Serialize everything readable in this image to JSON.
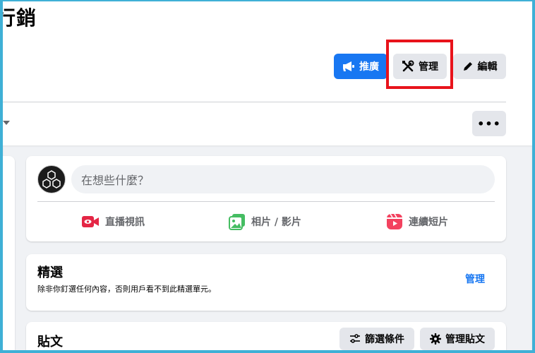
{
  "header": {
    "title": "行銷"
  },
  "actions": {
    "promote_label": "推廣",
    "manage_label": "管理",
    "edit_label": "編輯"
  },
  "tabs_row": {
    "more_label": "•••"
  },
  "composer": {
    "placeholder": "在想些什麼？",
    "live_label": "直播視訊",
    "photo_label": "相片 / 影片",
    "reel_label": "連續短片"
  },
  "featured": {
    "title": "精選",
    "description": "除非你釘選任何內容，否則用戶看不到此精選單元。",
    "manage_label": "管理"
  },
  "posts": {
    "title": "貼文",
    "filter_label": "篩選條件",
    "manage_label": "管理貼文"
  },
  "colors": {
    "accent": "#1877f2",
    "highlight": "#e8131b",
    "button_gray": "#e4e6eb",
    "feed_bg": "#f0f2f5",
    "live_red": "#e42645",
    "photo_green": "#45bd62",
    "reel_pink": "#f3425f"
  },
  "icons": {
    "promote": "megaphone-icon",
    "manage": "tools-icon",
    "edit": "pencil-icon",
    "live": "live-video-icon",
    "photo": "photo-icon",
    "reel": "reel-icon",
    "filter": "sliders-icon",
    "manage_posts": "gear-icon"
  }
}
